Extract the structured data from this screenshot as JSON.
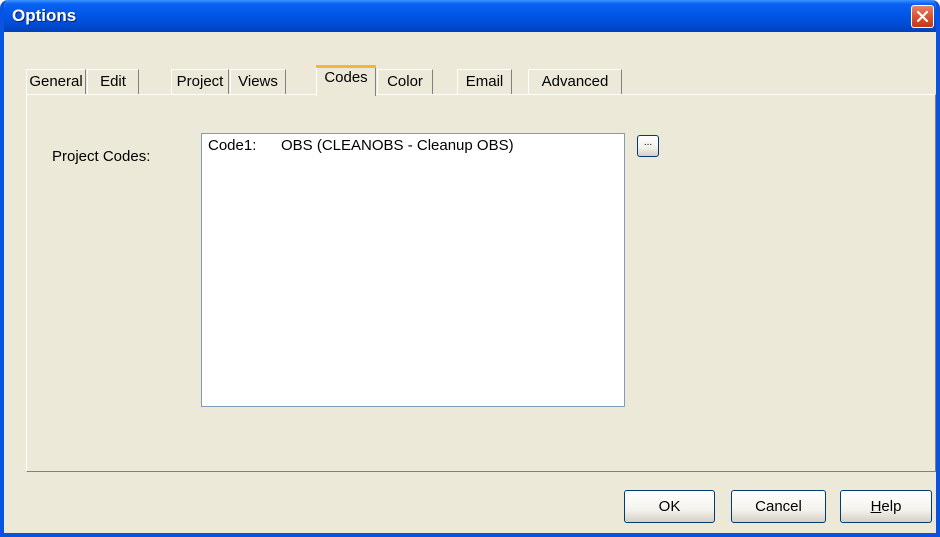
{
  "window": {
    "title": "Options"
  },
  "tabs": [
    {
      "label": "General"
    },
    {
      "label": "Edit"
    },
    {
      "label": "Project"
    },
    {
      "label": "Views"
    },
    {
      "label": "Codes",
      "active": true
    },
    {
      "label": "Color"
    },
    {
      "label": "Email"
    },
    {
      "label": "Advanced"
    }
  ],
  "codes_panel": {
    "field_label": "Project Codes:",
    "codes": [
      {
        "key": "Code1:",
        "value": "OBS (CLEANOBS - Cleanup OBS)"
      }
    ],
    "browse_label": "..."
  },
  "buttons": {
    "ok": "OK",
    "cancel": "Cancel",
    "help_mnemonic": "H",
    "help_rest": "elp"
  },
  "colors": {
    "titlebar": "#0055e5",
    "dialog_bg": "#ece9d8",
    "active_tab_accent": "#f8b33a",
    "close_button": "#d8542e"
  },
  "icons": {
    "close": "close-x-icon"
  }
}
